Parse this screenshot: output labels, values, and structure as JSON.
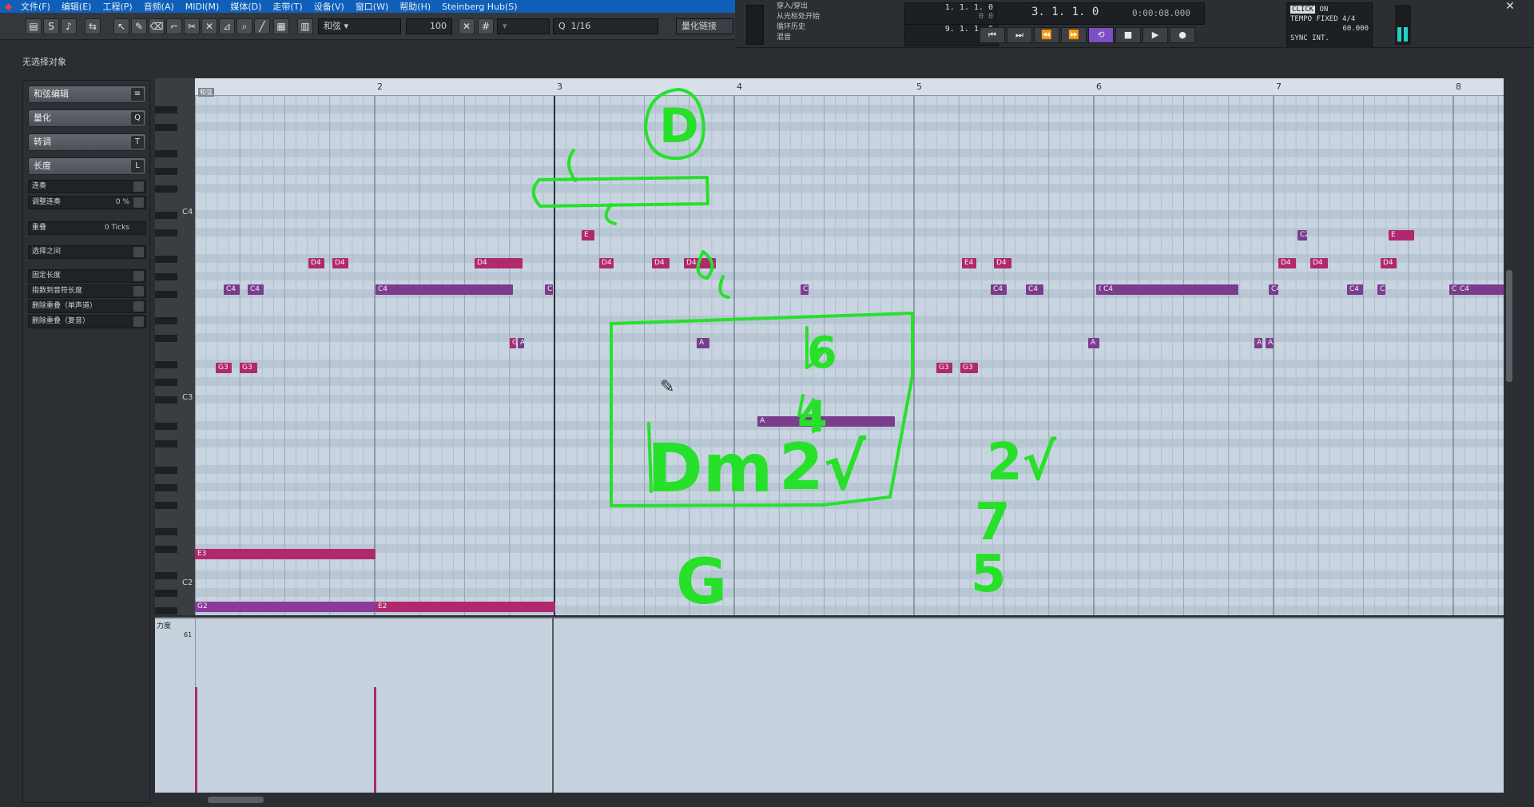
{
  "window": {
    "app_title": "Steinberg Hub(S)"
  },
  "menu": [
    {
      "label": "文件(F)"
    },
    {
      "label": "编辑(E)"
    },
    {
      "label": "工程(P)"
    },
    {
      "label": "音频(A)"
    },
    {
      "label": "MIDI(M)"
    },
    {
      "label": "媒体(D)"
    },
    {
      "label": "走带(T)"
    },
    {
      "label": "设备(V)"
    },
    {
      "label": "窗口(W)"
    },
    {
      "label": "帮助(H)"
    },
    {
      "label": "Steinberg Hub(S)"
    }
  ],
  "toolbar": {
    "chord_label": "和弦",
    "velocity": "100",
    "quantize_label": "Q",
    "quantize_value": "1/16",
    "quantize_link": "量化链接"
  },
  "transport": {
    "punch_items": [
      "穿入/穿出",
      "从光标处开始",
      "循环历史",
      "混音"
    ],
    "left_locator": "1. 1. 1.  0",
    "left_sub": "0   0",
    "right_locator": "9. 1. 1.  0",
    "right_sub": "0   0",
    "position_bars": "3. 1. 1.  0",
    "position_time": "0:00:08.000",
    "click": "CLICK",
    "click_state": "ON",
    "tempo_label": "TEMPO",
    "tempo_mode": "FIXED",
    "time_sig": "4/4",
    "tempo_value": "60.000",
    "sync": "SYNC",
    "sync_mode": "INT."
  },
  "status": {
    "selection": "无选择对象"
  },
  "inspector": {
    "sections": [
      {
        "label": "和弦编辑",
        "key": "≡"
      },
      {
        "label": "量化",
        "key": "Q"
      },
      {
        "label": "转调",
        "key": "T"
      },
      {
        "label": "长度",
        "key": "L"
      }
    ],
    "rows_a": [
      {
        "label": "连奏",
        "value": ""
      },
      {
        "label": "调整连奏",
        "value": "0 %"
      },
      {
        "label": "重叠",
        "value": "0 Ticks"
      },
      {
        "label": "选择之间",
        "value": ""
      }
    ],
    "rows_b": [
      {
        "label": "固定长度"
      },
      {
        "label": "指数到音符长度"
      },
      {
        "label": "删除重叠（单声道）"
      },
      {
        "label": "删除重叠（复音）"
      }
    ]
  },
  "editor": {
    "bars": [
      "2",
      "3",
      "4",
      "5",
      "6",
      "7",
      "8"
    ],
    "chord_track_label": "和弦",
    "pitch_labels": [
      "C4",
      "C3",
      "C2"
    ],
    "velocity_lane_label": "力度",
    "velocity_value": "61",
    "notes": [
      "E",
      "D4",
      "D4",
      "D4",
      "D4",
      "D4",
      "D4",
      "C4",
      "C4",
      "C4",
      "C",
      "C4",
      "C4",
      "C4",
      "C4",
      "C4",
      "C",
      "C4",
      "C",
      "C4",
      "C",
      "G3",
      "G3",
      "G3",
      "G3",
      "G3",
      "A",
      "A",
      "A",
      "A",
      "A",
      "A",
      "E3",
      "G2",
      "E2",
      "E2",
      "C2",
      "C2",
      "E",
      "E4",
      "D4",
      "D4",
      "D4",
      "D4"
    ]
  },
  "annotations": {
    "handwritten": [
      "D",
      "6",
      "4",
      "Dm",
      "2√",
      "2√",
      "7",
      "5",
      "G"
    ]
  },
  "colors": {
    "note_magenta": "#b0286e",
    "note_purple": "#8a3a9a",
    "note_violet": "#7a3c8c",
    "annotation_green": "#27e02a",
    "menu_blue": "#0f5fb8"
  }
}
